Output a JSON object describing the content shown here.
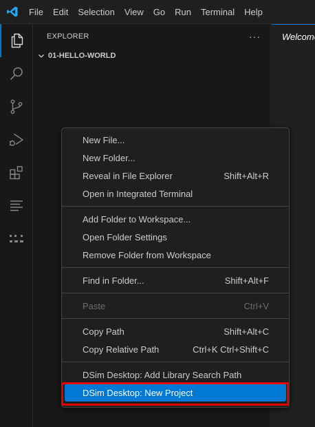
{
  "menubar": [
    "File",
    "Edit",
    "Selection",
    "View",
    "Go",
    "Run",
    "Terminal",
    "Help"
  ],
  "sidebar": {
    "title": "EXPLORER",
    "more": "···",
    "folder": "01-HELLO-WORLD"
  },
  "editor": {
    "tab_label": "Welcome"
  },
  "context_menu": {
    "groups": [
      [
        {
          "label": "New File...",
          "shortcut": ""
        },
        {
          "label": "New Folder...",
          "shortcut": ""
        },
        {
          "label": "Reveal in File Explorer",
          "shortcut": "Shift+Alt+R"
        },
        {
          "label": "Open in Integrated Terminal",
          "shortcut": ""
        }
      ],
      [
        {
          "label": "Add Folder to Workspace...",
          "shortcut": ""
        },
        {
          "label": "Open Folder Settings",
          "shortcut": ""
        },
        {
          "label": "Remove Folder from Workspace",
          "shortcut": ""
        }
      ],
      [
        {
          "label": "Find in Folder...",
          "shortcut": "Shift+Alt+F"
        }
      ],
      [
        {
          "label": "Paste",
          "shortcut": "Ctrl+V",
          "disabled": true
        }
      ],
      [
        {
          "label": "Copy Path",
          "shortcut": "Shift+Alt+C"
        },
        {
          "label": "Copy Relative Path",
          "shortcut": "Ctrl+K Ctrl+Shift+C"
        }
      ],
      [
        {
          "label": "DSim Desktop: Add Library Search Path",
          "shortcut": ""
        },
        {
          "label": "DSim Desktop: New Project",
          "shortcut": "",
          "selected": true
        }
      ]
    ]
  },
  "colors": {
    "accent": "#0078d4",
    "highlight_border": "#e00000",
    "vscode_blue": "#23a9f2"
  },
  "icons": [
    "vscode-logo-icon",
    "explorer-icon",
    "search-icon",
    "source-control-icon",
    "run-debug-icon",
    "extensions-icon",
    "outline-icon",
    "dsim-icon",
    "chevron-down-icon"
  ]
}
